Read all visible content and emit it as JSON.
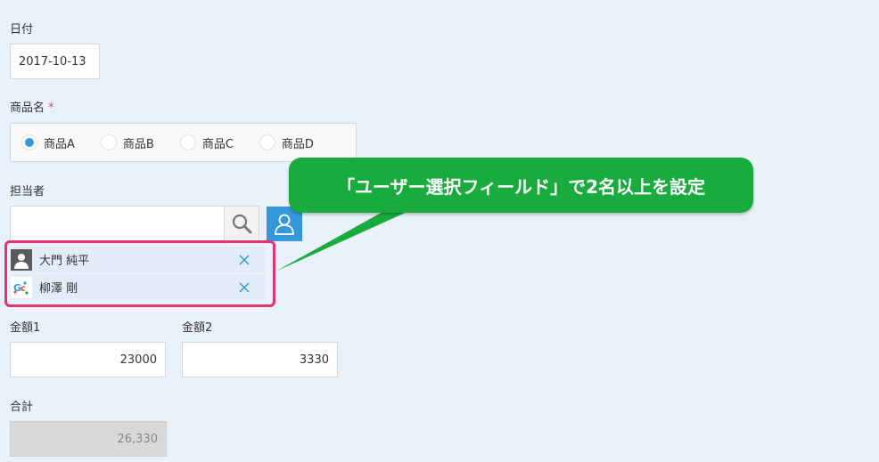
{
  "date": {
    "label": "日付",
    "value": "2017-10-13"
  },
  "product": {
    "label": "商品名",
    "required_mark": "*",
    "options": [
      {
        "label": "商品A",
        "checked": true
      },
      {
        "label": "商品B",
        "checked": false
      },
      {
        "label": "商品C",
        "checked": false
      },
      {
        "label": "商品D",
        "checked": false
      }
    ]
  },
  "assignee": {
    "label": "担当者",
    "search_value": "",
    "users": [
      {
        "name": "大門 純平",
        "avatar": "person-silhouette-icon"
      },
      {
        "name": "柳澤 剛",
        "avatar": "logo-icon"
      }
    ]
  },
  "amount1": {
    "label": "金額1",
    "value": "23000"
  },
  "amount2": {
    "label": "金額2",
    "value": "3330"
  },
  "total": {
    "label": "合計",
    "value": "26,330"
  },
  "callout": {
    "text": "「ユーザー選択フィールド」で2名以上を設定"
  },
  "colors": {
    "accent": "#3498db",
    "callout": "#1aab3e",
    "highlight": "#e8336d",
    "required": "#e74c3c"
  }
}
